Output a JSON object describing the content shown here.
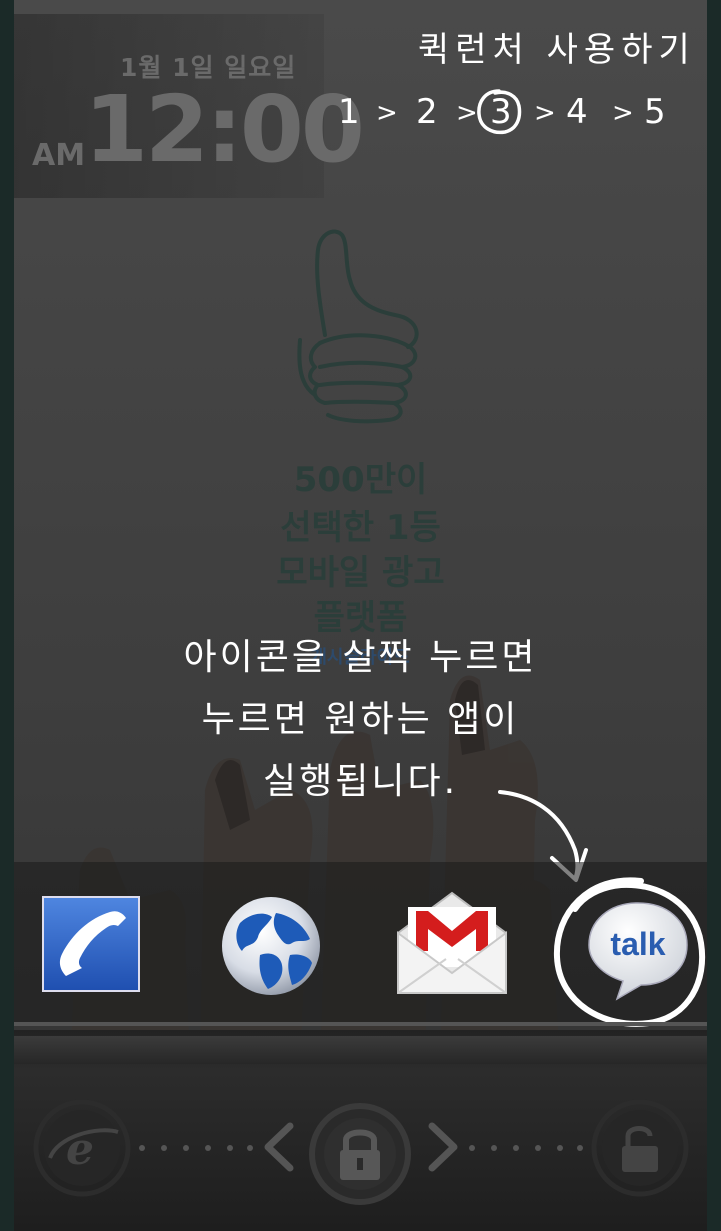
{
  "lockscreen": {
    "date": "1월 1일 일요일",
    "ampm": "AM",
    "time": "12:00"
  },
  "tutorial": {
    "title": "퀵런처 사용하기",
    "steps": [
      "1",
      ">",
      "2",
      ">",
      "3",
      ">",
      "4",
      ">",
      "5"
    ],
    "current_step": 3,
    "instruction_lines": [
      "아이콘을 살짝 누르면",
      "누르면 원하는 앱이",
      "실행됩니다."
    ]
  },
  "ad": {
    "lines": [
      "500만이",
      "선택한 1등",
      "모바일 광고",
      "플랫폼"
    ],
    "brand": "캐시슬라이드"
  },
  "dock": {
    "apps": [
      {
        "name": "phone",
        "icon": "phone-icon"
      },
      {
        "name": "browser",
        "icon": "globe-icon"
      },
      {
        "name": "gmail",
        "icon": "gmail-icon"
      },
      {
        "name": "talk",
        "icon": "talk-icon",
        "label": "talk"
      }
    ]
  },
  "lockbar": {
    "left": "browser-e-icon",
    "center": "lock-icon",
    "right": "unlock-icon"
  },
  "colors": {
    "clock_text": "#6a6a6a",
    "ad_text": "#2b3e3a",
    "instruction_text": "#ffffff",
    "frame": "#1b2a28"
  }
}
